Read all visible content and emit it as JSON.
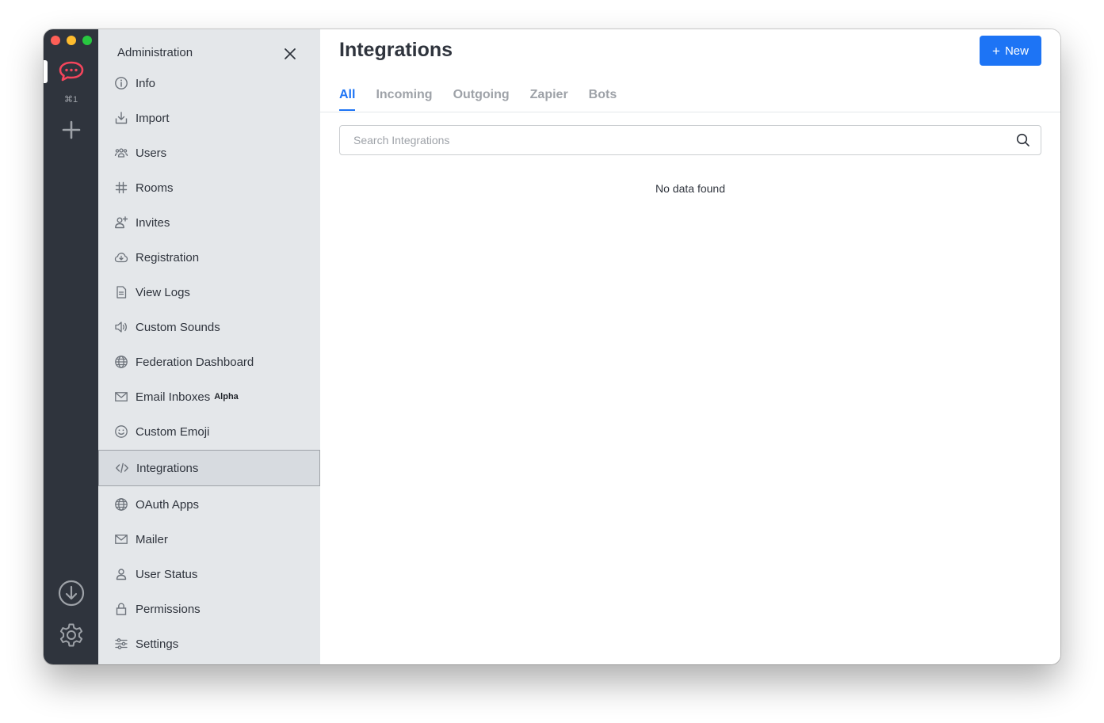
{
  "rail": {
    "shortcut": "⌘1"
  },
  "sidebar": {
    "title": "Administration",
    "items": [
      {
        "label": "Info",
        "icon": "info-icon"
      },
      {
        "label": "Import",
        "icon": "import-icon"
      },
      {
        "label": "Users",
        "icon": "users-icon"
      },
      {
        "label": "Rooms",
        "icon": "hashtag-icon"
      },
      {
        "label": "Invites",
        "icon": "user-plus-icon"
      },
      {
        "label": "Registration",
        "icon": "cloud-icon"
      },
      {
        "label": "View Logs",
        "icon": "document-icon"
      },
      {
        "label": "Custom Sounds",
        "icon": "volume-icon"
      },
      {
        "label": "Federation Dashboard",
        "icon": "globe-icon"
      },
      {
        "label": "Email Inboxes",
        "icon": "mail-icon",
        "badge": "Alpha"
      },
      {
        "label": "Custom Emoji",
        "icon": "emoji-icon"
      },
      {
        "label": "Integrations",
        "icon": "code-icon",
        "active": true
      },
      {
        "label": "OAuth Apps",
        "icon": "globe-icon"
      },
      {
        "label": "Mailer",
        "icon": "mail-icon"
      },
      {
        "label": "User Status",
        "icon": "user-icon"
      },
      {
        "label": "Permissions",
        "icon": "lock-icon"
      },
      {
        "label": "Settings",
        "icon": "sliders-icon"
      }
    ]
  },
  "main": {
    "title": "Integrations",
    "new_button": "New",
    "tabs": [
      {
        "label": "All",
        "active": true
      },
      {
        "label": "Incoming"
      },
      {
        "label": "Outgoing"
      },
      {
        "label": "Zapier"
      },
      {
        "label": "Bots"
      }
    ],
    "search": {
      "placeholder": "Search Integrations",
      "value": ""
    },
    "empty_message": "No data found"
  },
  "colors": {
    "rail_bg": "#2f343d",
    "sidebar_bg": "#e4e7ea",
    "accent": "#1d74f5",
    "logo_red": "#f5455c"
  }
}
